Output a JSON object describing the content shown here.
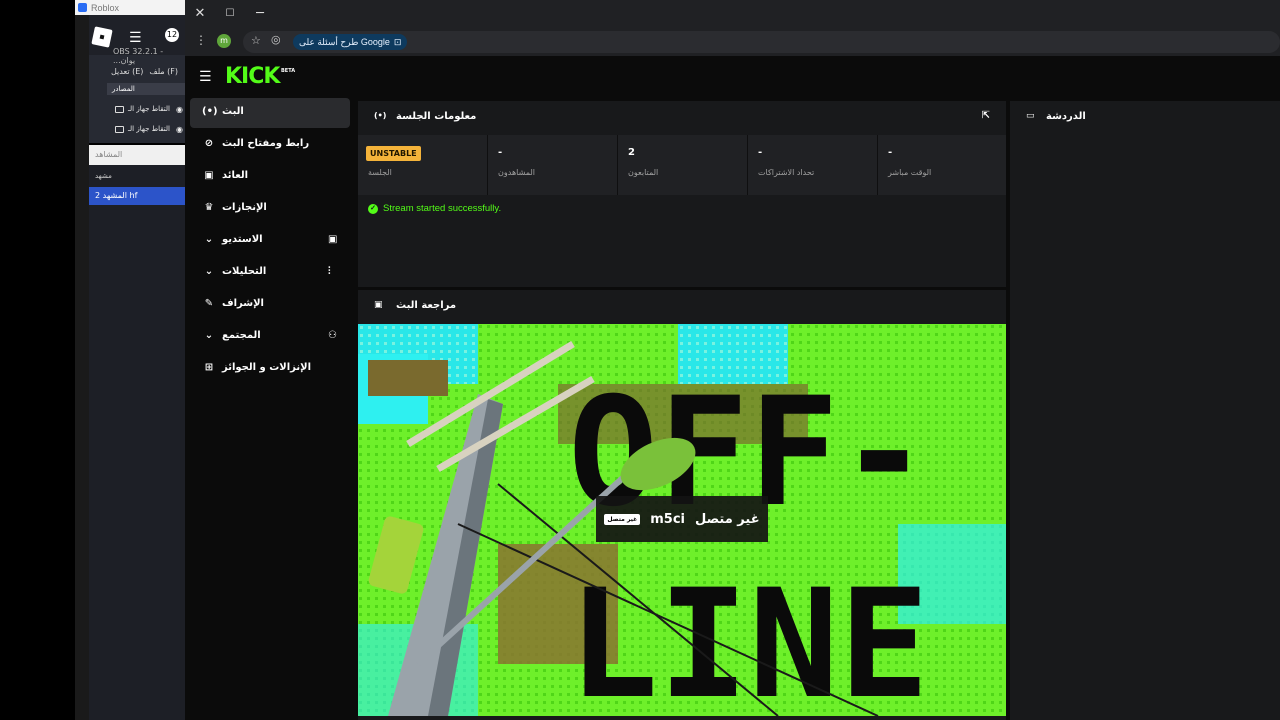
{
  "background": {
    "roblox_title": "Roblox",
    "obs": {
      "version": "OBS 32.2.1 - ...يوان",
      "badge": "12",
      "menu": [
        "ملف (F)",
        "تعديل (E)"
      ],
      "sources_header": "المصادر",
      "sources": [
        "التقاط جهاز الـ",
        "التقاط جهاز الـ"
      ],
      "scenes_header": "المشاهد",
      "scene_label": "مشهد",
      "scene_selected": "المشهد 2 hf"
    }
  },
  "browser": {
    "window_buttons": [
      "✕",
      "☐",
      "─"
    ],
    "profile_initial": "m",
    "google_chip": "طرح أسئلة على Google"
  },
  "kick": {
    "logo": "KICK",
    "beta": "BETA",
    "nav": [
      {
        "label": "البث",
        "icon": "(•)",
        "active": true
      },
      {
        "label": "رابط ومفتاح البث",
        "icon": "⊘"
      },
      {
        "label": "العائد",
        "icon": "▣"
      },
      {
        "label": "الإنجازات",
        "icon": "♛"
      },
      {
        "label": "الاستديو",
        "icon": "▣",
        "expand": true
      },
      {
        "label": "التحليلات",
        "icon": "⫶",
        "expand": true
      },
      {
        "label": "الإشراف",
        "icon": "✎"
      },
      {
        "label": "المجتمع",
        "icon": "⚇",
        "expand": true
      },
      {
        "label": "الإنزالات و الجوائز",
        "icon": "⊞"
      }
    ],
    "session": {
      "title": "معلومات الجلسة",
      "stats": [
        {
          "value": "UNSTABLE",
          "caption": "الجلسة"
        },
        {
          "value": "-",
          "caption": "المشاهدون"
        },
        {
          "value": "2",
          "caption": "المتابعون"
        },
        {
          "value": "-",
          "caption": "تحداد الاشتراكات"
        },
        {
          "value": "-",
          "caption": "الوقت مباشر"
        }
      ],
      "status": "Stream started successfully."
    },
    "preview": {
      "title": "مراجعة البث",
      "offline_line1": "OFF-",
      "offline_line2": "LINE",
      "channel_name": "m5ci",
      "offline_text": "غير متصل",
      "badge": "غير متصل"
    },
    "chat": {
      "title": "الدردشة"
    }
  },
  "colors": {
    "kick_green": "#53fc18",
    "unstable": "#f4b33a",
    "panel": "#18191b"
  }
}
